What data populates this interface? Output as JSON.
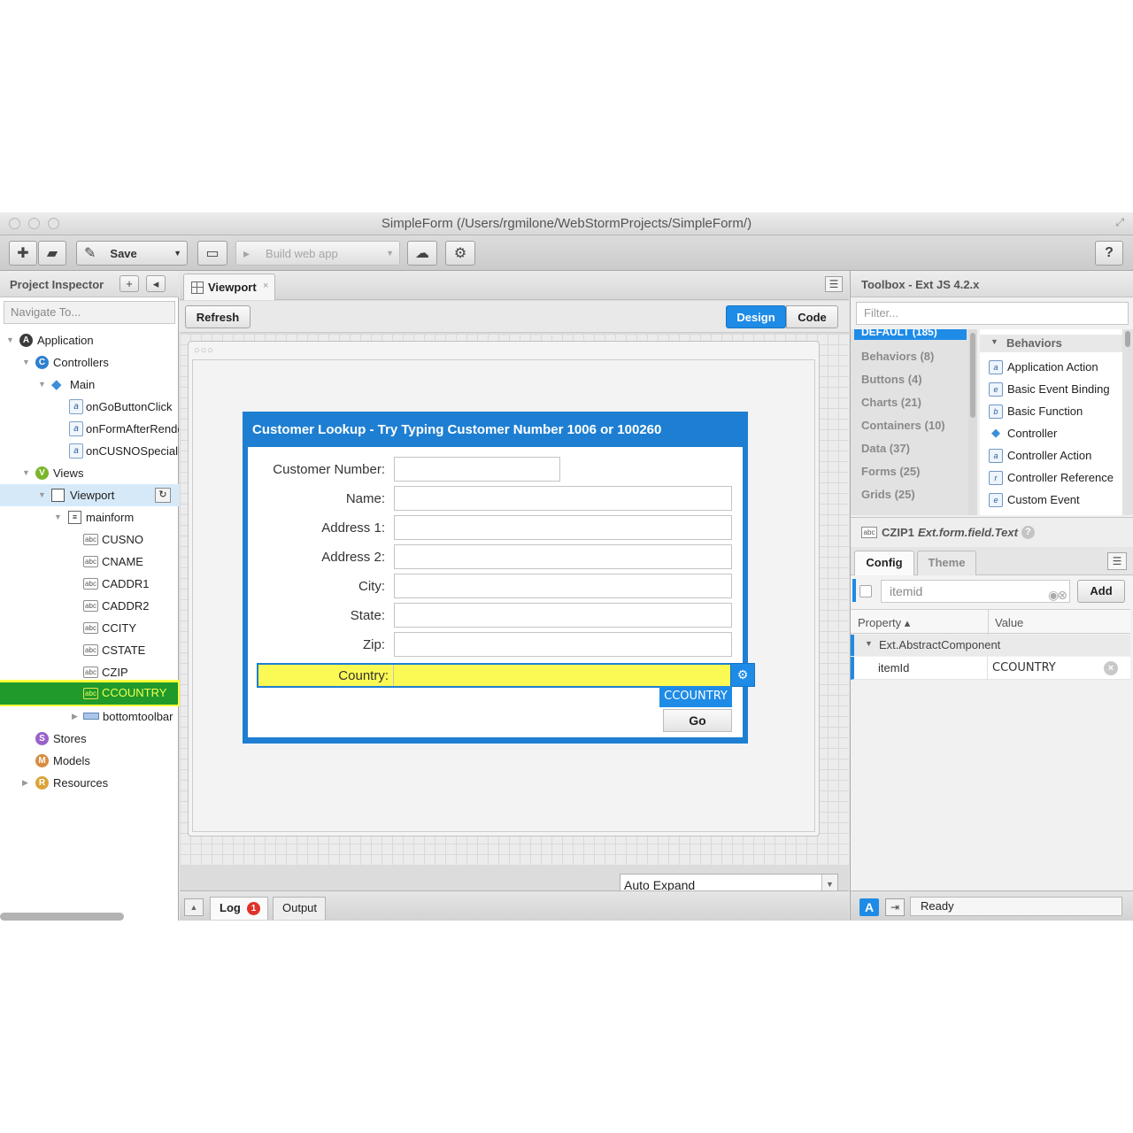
{
  "window": {
    "title": "SimpleForm (/Users/rgmilone/WebStormProjects/SimpleForm/)"
  },
  "toolbar": {
    "save_label": "Save",
    "build_label": "Build web app"
  },
  "inspector": {
    "title": "Project Inspector",
    "add_label": "+",
    "collapse_label": "◂",
    "nav_placeholder": "Navigate To...",
    "tree": {
      "application": "Application",
      "controllers": "Controllers",
      "main": "Main",
      "fn1": "onGoButtonClick",
      "fn2": "onFormAfterRender",
      "fn3": "onCUSNOSpecialkey",
      "views": "Views",
      "viewport": "Viewport",
      "mainform": "mainform",
      "f1": "CUSNO",
      "f2": "CNAME",
      "f3": "CADDR1",
      "f4": "CADDR2",
      "f5": "CCITY",
      "f6": "CSTATE",
      "f7": "CZIP",
      "f8": "CCOUNTRY",
      "bottomtoolbar": "bottomtoolbar",
      "stores": "Stores",
      "models": "Models",
      "resources": "Resources"
    }
  },
  "center": {
    "tab_label": "Viewport",
    "tab_close": "×",
    "refresh_label": "Refresh",
    "design_label": "Design",
    "code_label": "Code",
    "frame_dots": "○○○",
    "form": {
      "title": "Customer Lookup - Try Typing Customer Number 1006 or 100260",
      "labels": [
        "Customer Number:",
        "Name:",
        "Address 1:",
        "Address 2:",
        "City:",
        "State:",
        "Zip:"
      ],
      "country_label": "Country:",
      "tag": "CCOUNTRY",
      "go_label": "Go"
    },
    "auto_expand": "Auto Expand",
    "log_label": "Log",
    "log_count": "1",
    "output_label": "Output"
  },
  "toolbox": {
    "title": "Toolbox - Ext JS 4.2.x",
    "filter_placeholder": "Filter...",
    "default_cat": "DEFAULT (185)",
    "categories": [
      "Behaviors (8)",
      "Buttons (4)",
      "Charts (21)",
      "Containers (10)",
      "Data (37)",
      "Forms (25)",
      "Grids (25)"
    ],
    "section": "Behaviors",
    "items": [
      {
        "label": "Application Action",
        "glyph": "a"
      },
      {
        "label": "Basic Event Binding",
        "glyph": "e"
      },
      {
        "label": "Basic Function",
        "glyph": "b"
      },
      {
        "label": "Controller",
        "glyph": "◆"
      },
      {
        "label": "Controller Action",
        "glyph": "a"
      },
      {
        "label": "Controller Reference",
        "glyph": "r"
      },
      {
        "label": "Custom Event",
        "glyph": "e"
      }
    ]
  },
  "config": {
    "component_name": "CZIP1",
    "component_class": "Ext.form.field.Text",
    "help": "?",
    "tab_config": "Config",
    "tab_theme": "Theme",
    "search_placeholder": "itemid",
    "add_label": "Add",
    "col_property": "Property ▴",
    "col_value": "Value",
    "group": "Ext.AbstractComponent",
    "prop_key": "itemId",
    "prop_value": "CCOUNTRY"
  },
  "status": {
    "a_label": "A",
    "text": "Ready"
  },
  "colors": {
    "accent": "#1e8be6",
    "highlight": "#ffff3d",
    "selected_green": "#1f9a2b"
  }
}
